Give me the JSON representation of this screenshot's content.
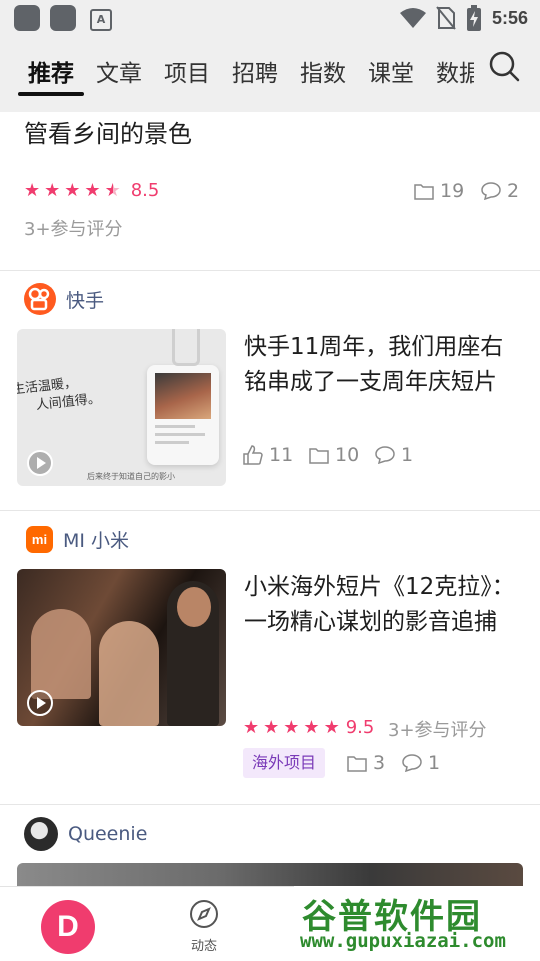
{
  "status_bar": {
    "time": "5:56",
    "badge": "A"
  },
  "tabs": {
    "items": [
      {
        "label": "推荐",
        "active": true
      },
      {
        "label": "文章"
      },
      {
        "label": "项目"
      },
      {
        "label": "招聘"
      },
      {
        "label": "指数"
      },
      {
        "label": "课堂"
      },
      {
        "label": "数据"
      }
    ],
    "search_icon": "search-icon"
  },
  "post_top": {
    "title": "管看乡间的景色",
    "rating": "8.5",
    "stars": 4.5,
    "collects": "19",
    "comments": "2",
    "raters": "3+参与评分"
  },
  "post_kuaishou": {
    "author": "快手",
    "title": "快手11周年，我们用座右铭串成了一支周年庆短片",
    "likes": "11",
    "collects": "10",
    "comments": "1",
    "thumb_text_1": "生活温暖，",
    "thumb_text_2": "人间值得。",
    "thumb_caption": "后来终于知道自己的影小"
  },
  "post_xiaomi": {
    "author": "MI 小米",
    "logo_text": "mi",
    "title": "小米海外短片《12克拉》：一场精心谋划的影音追捕",
    "rating": "9.5",
    "stars": 5,
    "raters": "3+参与评分",
    "tag": "海外项目",
    "collects": "3",
    "comments": "1"
  },
  "post_queenie": {
    "author": "Queenie"
  },
  "bottom_nav": {
    "home_letter": "D",
    "dynamic_label": "动态"
  },
  "watermark": {
    "logo": "谷普软件园",
    "url": "www.gupuxiazai.com"
  },
  "colors": {
    "accent": "#f03c6e",
    "author": "#4a5a80",
    "tag_bg": "#f3e8fb",
    "tag_text": "#7a3ab8",
    "watermark": "#2e8b2e"
  }
}
